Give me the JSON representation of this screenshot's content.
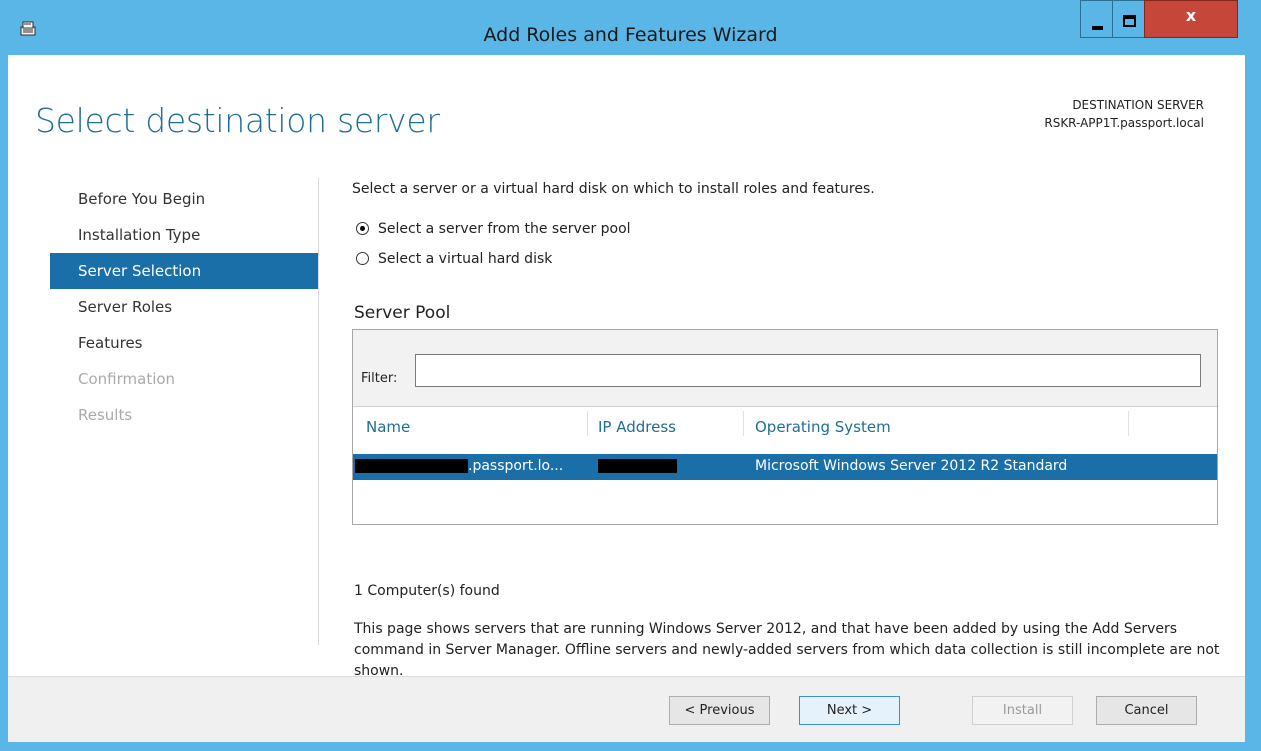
{
  "window": {
    "title": "Add Roles and Features Wizard",
    "close_glyph": "x"
  },
  "header": {
    "page_title": "Select destination server",
    "dest_label": "DESTINATION SERVER",
    "dest_server": "RSKR-APP1T.passport.local"
  },
  "nav": {
    "items": [
      {
        "label": "Before You Begin",
        "state": "normal"
      },
      {
        "label": "Installation Type",
        "state": "normal"
      },
      {
        "label": "Server Selection",
        "state": "active"
      },
      {
        "label": "Server Roles",
        "state": "normal"
      },
      {
        "label": "Features",
        "state": "normal"
      },
      {
        "label": "Confirmation",
        "state": "disabled"
      },
      {
        "label": "Results",
        "state": "disabled"
      }
    ]
  },
  "content": {
    "intro": "Select a server or a virtual hard disk on which to install roles and features.",
    "radio_pool": "Select a server from the server pool",
    "radio_vhd": "Select a virtual hard disk",
    "pool_title": "Server Pool",
    "filter_label": "Filter:",
    "filter_value": "",
    "columns": {
      "name": "Name",
      "ip": "IP Address",
      "os": "Operating System"
    },
    "rows": [
      {
        "name_suffix": ".passport.lo...",
        "os": "Microsoft Windows Server 2012 R2 Standard"
      }
    ],
    "found": "1 Computer(s) found",
    "note": "This page shows servers that are running Windows Server 2012, and that have been added by using the Add Servers command in Server Manager. Offline servers and newly-added servers from which data collection is still incomplete are not shown."
  },
  "footer": {
    "previous": "< Previous",
    "next": "Next >",
    "install": "Install",
    "cancel": "Cancel"
  },
  "colors": {
    "titlebar": "#5bb6e8",
    "accent": "#1b6fa8",
    "title_text": "#1f6e95",
    "close_button": "#c7463a"
  }
}
